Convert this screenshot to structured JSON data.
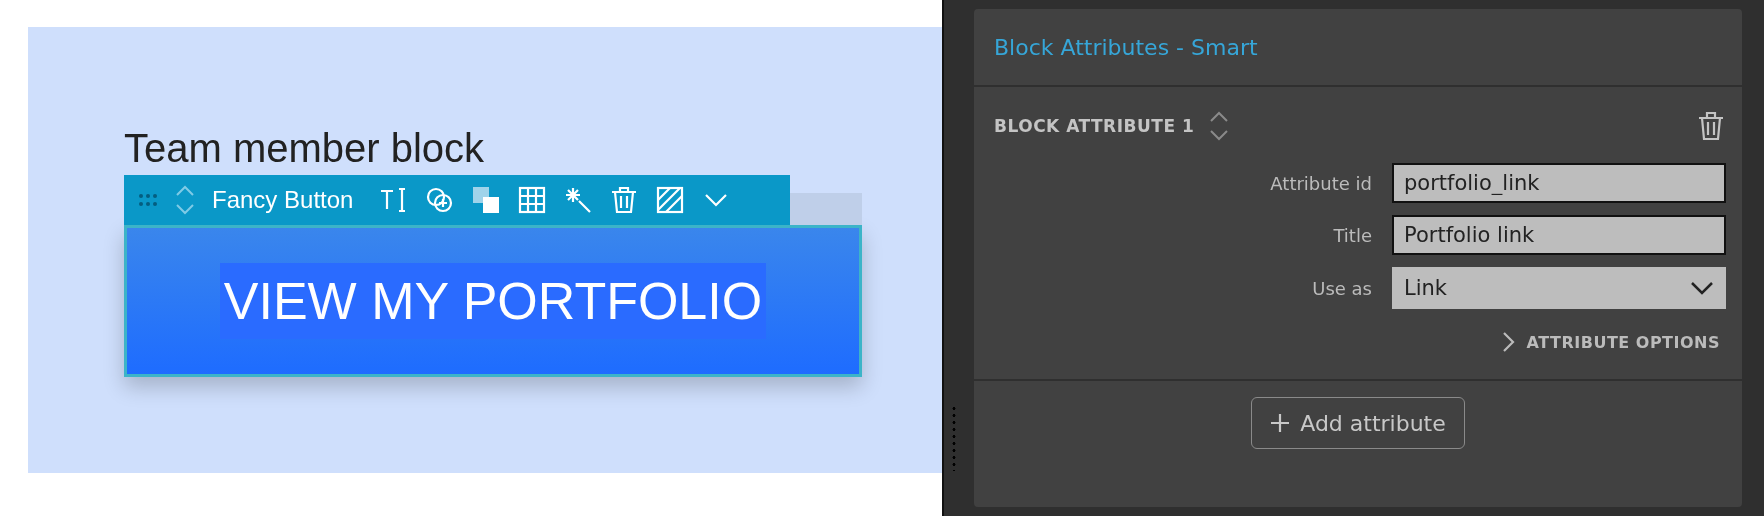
{
  "canvas": {
    "heading": "Team member block",
    "toolbar": {
      "title": "Fancy Button"
    },
    "button": {
      "label": "VIEW MY PORTFOLIO",
      "text_selected": true
    }
  },
  "panel": {
    "title": "Block Attributes - Smart",
    "attribute": {
      "heading": "BLOCK ATTRIBUTE 1",
      "fields": [
        {
          "kind": "text",
          "label": "Attribute id",
          "value": "portfolio_link"
        },
        {
          "kind": "text",
          "label": "Title",
          "value": "Portfolio link"
        },
        {
          "kind": "select",
          "label": "Use as",
          "value": "Link"
        }
      ],
      "options": {
        "label": "ATTRIBUTE OPTIONS",
        "expanded": false
      }
    },
    "add_button": "Add attribute"
  }
}
